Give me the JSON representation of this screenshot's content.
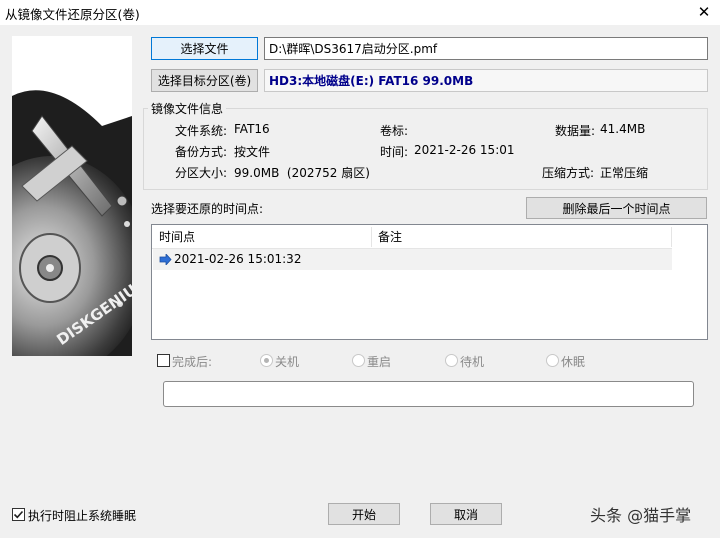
{
  "window": {
    "title": "从镜像文件还原分区(卷)",
    "close_glyph": "✕"
  },
  "source": {
    "select_file_label": "选择文件",
    "file_path": "D:\\群晖\\DS3617启动分区.pmf",
    "select_target_label": "选择目标分区(卷)",
    "target_text": "HD3:本地磁盘(E:) FAT16 99.0MB"
  },
  "info": {
    "group_label": "镜像文件信息",
    "fs_label": "文件系统:",
    "fs_value": "FAT16",
    "volume_label": "卷标:",
    "volume_value": "",
    "data_label": "数据量:",
    "data_value": "41.4MB",
    "backup_label": "备份方式:",
    "backup_value": "按文件",
    "time_label": "时间:",
    "time_value": "2021-2-26 15:01",
    "size_label": "分区大小:",
    "size_value": "99.0MB  (202752 扇区)",
    "compress_label": "压缩方式:",
    "compress_value": "正常压缩"
  },
  "timepoints": {
    "prompt": "选择要还原的时间点:",
    "delete_last_label": "删除最后一个时间点",
    "col_time": "时间点",
    "col_note": "备注",
    "rows": [
      {
        "time": "2021-02-26 15:01:32",
        "note": ""
      }
    ]
  },
  "after": {
    "checkbox_label": "完成后:",
    "checked": false,
    "options": [
      "关机",
      "重启",
      "待机",
      "休眠"
    ],
    "selected": "关机"
  },
  "progress": {
    "fraction": 0
  },
  "footer": {
    "prevent_sleep_label": "执行时阻止系统睡眠",
    "prevent_sleep_checked": true,
    "start_label": "开始",
    "cancel_label": "取消",
    "watermark": "头条 @猫手掌"
  },
  "colors": {
    "accent": "#0078d7",
    "target_text": "#00008b"
  }
}
